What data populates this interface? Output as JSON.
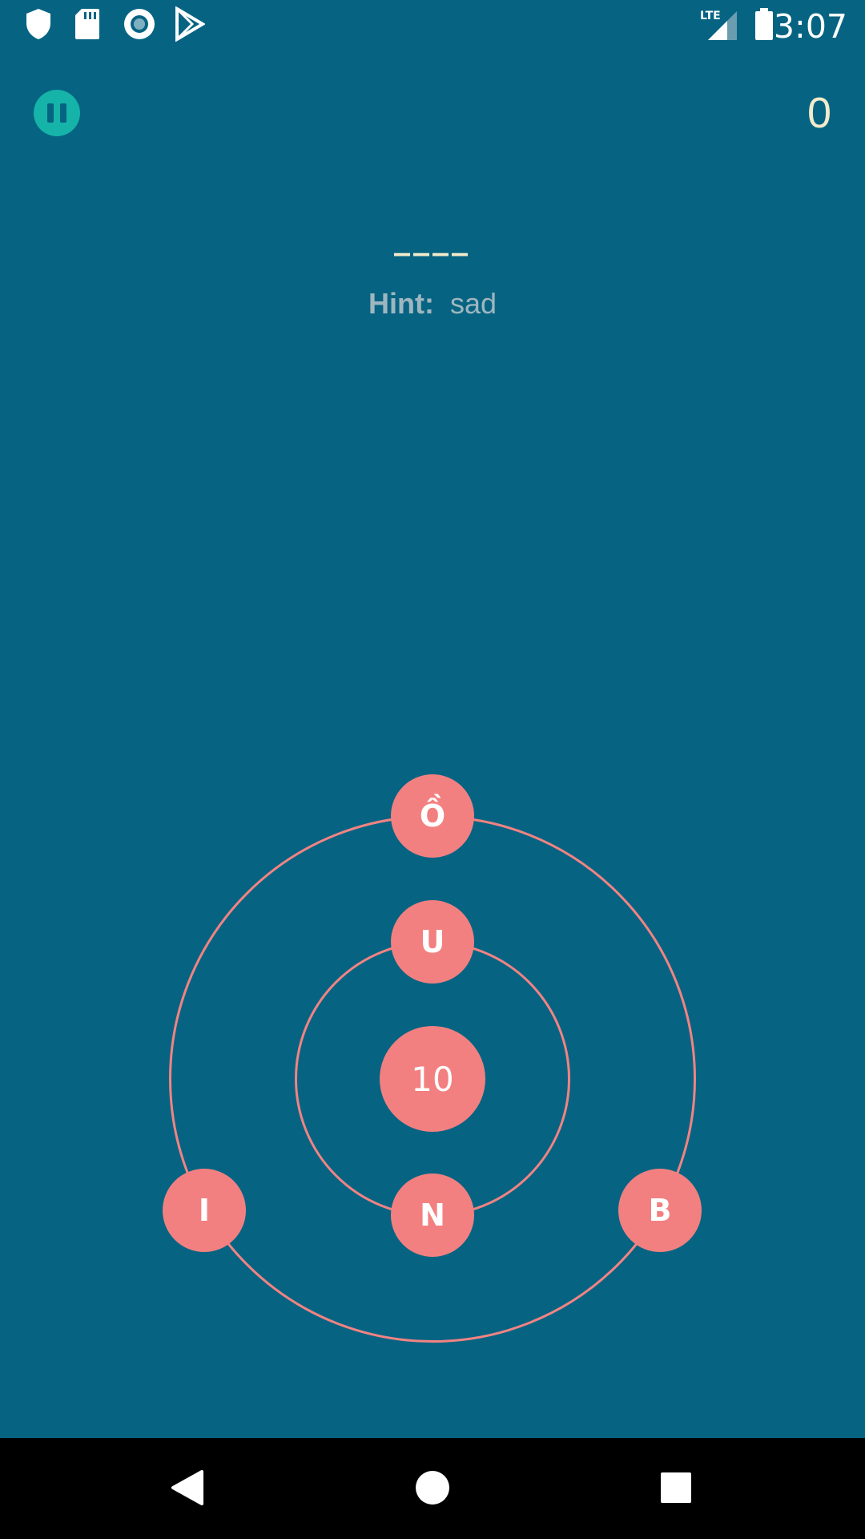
{
  "status_bar": {
    "time": "3:07",
    "left_icons": [
      "shield-icon",
      "sd-card-icon",
      "record-icon",
      "play-store-icon"
    ],
    "right_icons": [
      "lte-signal-icon",
      "battery-icon"
    ],
    "network_label": "LTE"
  },
  "game": {
    "pause_icon": "pause-icon",
    "score": "0",
    "answer_blanks": "____",
    "hint_label": "Hint:",
    "hint_text": "sad",
    "timer": "10",
    "letters": {
      "top": "Ồ",
      "inner_top": "U",
      "inner_bottom": "N",
      "left": "I",
      "right": "B"
    }
  },
  "colors": {
    "background": "#066482",
    "letter_circle": "#f38080",
    "pause_button": "#16b3a8",
    "score_text": "#f3ebcb"
  },
  "nav_bar": {
    "buttons": [
      "back-icon",
      "home-icon",
      "recents-icon"
    ]
  }
}
